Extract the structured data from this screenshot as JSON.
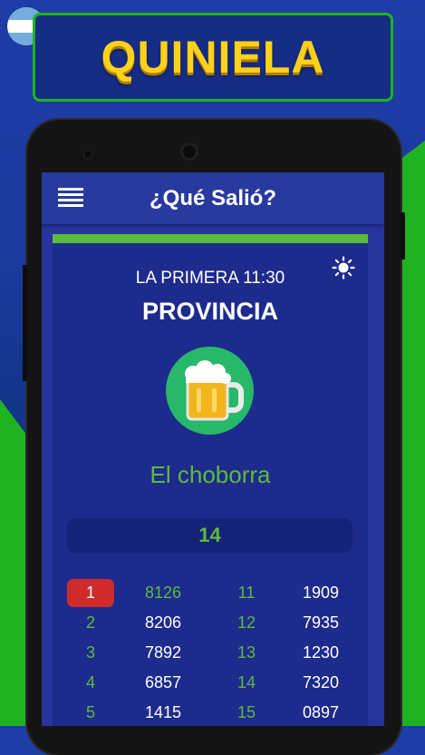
{
  "banner": {
    "title": "QUINIELA"
  },
  "app": {
    "title": "¿Qué Salió?"
  },
  "draw": {
    "lottery": "LA PRIMERA 11:30",
    "province": "PROVINCIA",
    "dream_name": "El choborra",
    "number": "14",
    "progress_fraction": 1.0
  },
  "results": [
    {
      "pos1": "1",
      "num1": "8126",
      "pos2": "11",
      "num2": "1909"
    },
    {
      "pos1": "2",
      "num1": "8206",
      "pos2": "12",
      "num2": "7935"
    },
    {
      "pos1": "3",
      "num1": "7892",
      "pos2": "13",
      "num2": "1230"
    },
    {
      "pos1": "4",
      "num1": "6857",
      "pos2": "14",
      "num2": "7320"
    },
    {
      "pos1": "5",
      "num1": "1415",
      "pos2": "15",
      "num2": "0897"
    }
  ],
  "icons": {
    "menu": "menu-icon",
    "theme": "sun-icon",
    "dream": "beer-mug-icon",
    "flag": "argentina-flag-icon"
  },
  "colors": {
    "accent_green": "#5dbb3c",
    "banner_yellow": "#ffd11a",
    "highlight_red": "#cf2b2b",
    "panel_blue": "#1d2b8c"
  }
}
